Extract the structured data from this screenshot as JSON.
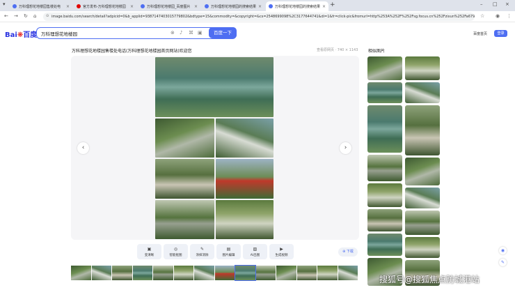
{
  "browser": {
    "tabs": [
      {
        "title": "万科理想花地楼园售楼处电",
        "fav_color": "#4e6ef2",
        "active": false
      },
      {
        "title": "官方发布-万科理想花地楼园",
        "fav_color": "#e10602",
        "active": false
      },
      {
        "title": "万科理想花地楼园_百度图片",
        "fav_color": "#4e6ef2",
        "active": false
      },
      {
        "title": "万科理想花地楼园的搜索结果",
        "fav_color": "#4e6ef2",
        "active": false
      },
      {
        "title": "万科理想花地楼园的搜索结果",
        "fav_color": "#4e6ef2",
        "active": true
      }
    ],
    "new_tab": "+",
    "url": "image.baidu.com/search/detail?adpicid=0&b_applid=9387147403015779802&bdtype=15&commodity=&copyright=&cs=2548699098%2C3177644741&di=1&fr=click-pic&fromurl=http%253A%252F%252Fsg.focus.cn%252Fzixun%252Fa67951263437e2..."
  },
  "header": {
    "logo_bai": "Bai",
    "logo_du": "百度",
    "search_value": "万科理想花地楼园",
    "search_button": "百度一下",
    "link_home": "百度首页",
    "login": "登录"
  },
  "viewer": {
    "title": "万科理想花地楼园售楼处电话(万科理想花地楼园首页网站)欢迎您",
    "meta": "查看原网页 · 740 × 1143",
    "prev": "‹",
    "next": "›"
  },
  "toolbar": [
    {
      "icon": "image-icon",
      "glyph": "▣",
      "label": "变清晰"
    },
    {
      "icon": "magic-icon",
      "glyph": "◎",
      "label": "智能抠图"
    },
    {
      "icon": "eraser-icon",
      "glyph": "✎",
      "label": "涂抹消除"
    },
    {
      "icon": "edit-icon",
      "glyph": "▤",
      "label": "图片编辑"
    },
    {
      "icon": "ai-image-icon",
      "glyph": "▨",
      "label": "AI出图"
    },
    {
      "icon": "video-icon",
      "glyph": "▶",
      "label": "生成视频"
    }
  ],
  "download": "⊕ 下载",
  "sidebar": {
    "title": "相似图片"
  },
  "float_buttons": [
    "◉",
    "✎"
  ],
  "watermark": "搜狐号@搜狐焦点防城港站"
}
